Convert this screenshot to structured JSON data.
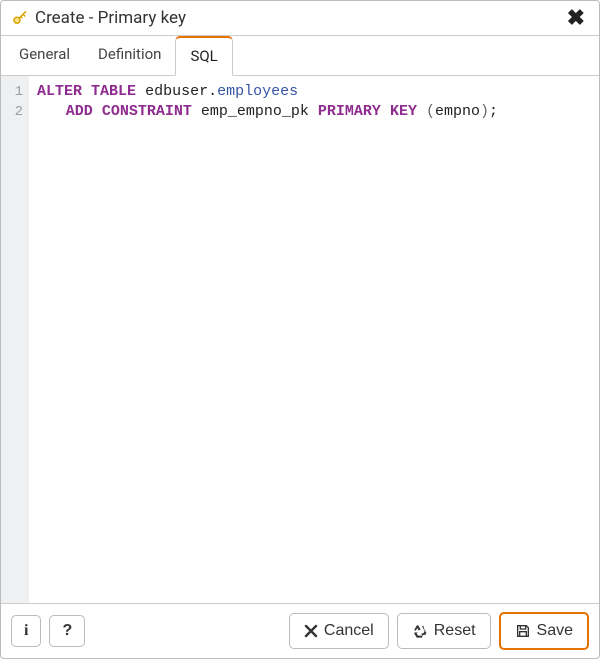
{
  "titlebar": {
    "icon": "key-icon",
    "title": "Create - Primary key"
  },
  "tabs": [
    {
      "id": "general",
      "label": "General",
      "active": false
    },
    {
      "id": "definition",
      "label": "Definition",
      "active": false
    },
    {
      "id": "sql",
      "label": "SQL",
      "active": true
    }
  ],
  "sql": {
    "lines": [
      {
        "num": 1,
        "tokens": [
          {
            "t": "ALTER",
            "cls": "kw"
          },
          {
            "t": " ",
            "cls": "plain"
          },
          {
            "t": "TABLE",
            "cls": "kw"
          },
          {
            "t": " ",
            "cls": "plain"
          },
          {
            "t": "edbuser",
            "cls": "plain"
          },
          {
            "t": ".",
            "cls": "plain"
          },
          {
            "t": "employees",
            "cls": "ident"
          }
        ]
      },
      {
        "num": 2,
        "indent": true,
        "tokens": [
          {
            "t": "ADD",
            "cls": "kw"
          },
          {
            "t": " ",
            "cls": "plain"
          },
          {
            "t": "CONSTRAINT",
            "cls": "kw"
          },
          {
            "t": " ",
            "cls": "plain"
          },
          {
            "t": "emp_empno_pk",
            "cls": "plain"
          },
          {
            "t": " ",
            "cls": "plain"
          },
          {
            "t": "PRIMARY",
            "cls": "kw"
          },
          {
            "t": " ",
            "cls": "plain"
          },
          {
            "t": "KEY",
            "cls": "kw"
          },
          {
            "t": " ",
            "cls": "plain"
          },
          {
            "t": "(",
            "cls": "punct"
          },
          {
            "t": "empno",
            "cls": "plain"
          },
          {
            "t": ")",
            "cls": "punct"
          },
          {
            "t": ";",
            "cls": "plain"
          }
        ]
      }
    ]
  },
  "footer": {
    "info_label": "i",
    "help_label": "?",
    "cancel_label": "Cancel",
    "reset_label": "Reset",
    "save_label": "Save"
  }
}
